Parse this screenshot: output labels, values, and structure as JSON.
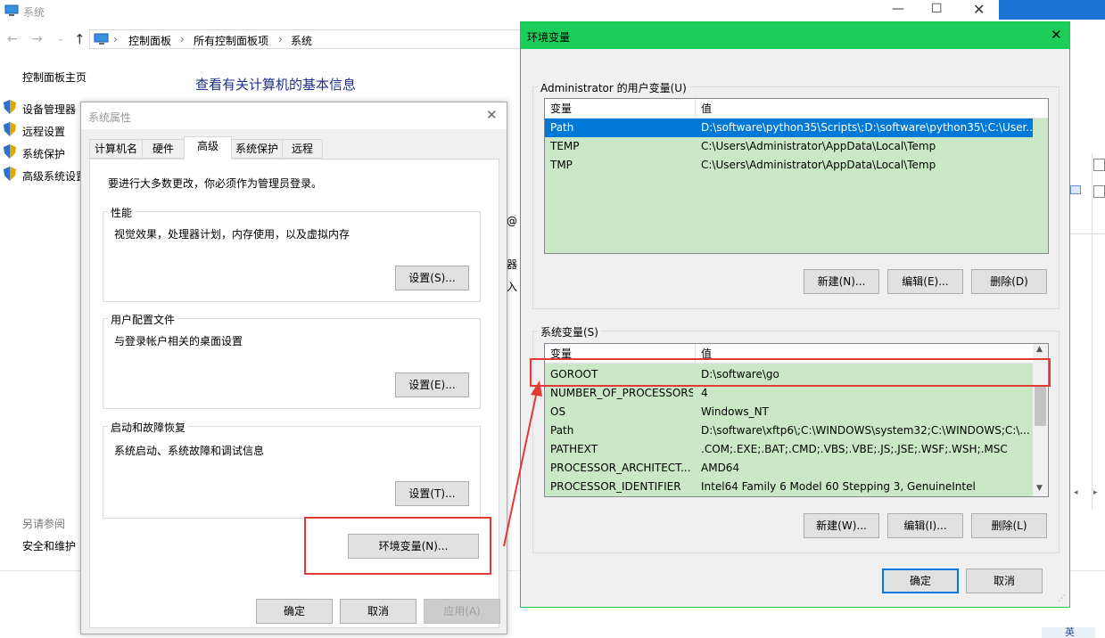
{
  "background_window": {
    "title": "系统",
    "breadcrumb": [
      "控制面板",
      "所有控制面板项",
      "系统"
    ],
    "heading": "查看有关计算机的基本信息",
    "left_nav": {
      "home": "控制面板主页",
      "items": [
        "设备管理器",
        "远程设置",
        "系统保护",
        "高级系统设置"
      ],
      "see_also": "另请参阅",
      "security": "安全和维护"
    },
    "partial_text": [
      "@",
      "器",
      "入"
    ]
  },
  "system_properties": {
    "title": "系统属性",
    "tabs": [
      "计算机名",
      "硬件",
      "高级",
      "系统保护",
      "远程"
    ],
    "active_tab": "高级",
    "admin_note": "要进行大多数更改，你必须作为管理员登录。",
    "performance": {
      "label": "性能",
      "desc": "视觉效果，处理器计划，内存使用，以及虚拟内存",
      "button": "设置(S)..."
    },
    "user_profiles": {
      "label": "用户配置文件",
      "desc": "与登录帐户相关的桌面设置",
      "button": "设置(E)..."
    },
    "startup_recovery": {
      "label": "启动和故障恢复",
      "desc": "系统启动、系统故障和调试信息",
      "button": "设置(T)..."
    },
    "env_button": "环境变量(N)...",
    "ok": "确定",
    "cancel": "取消",
    "apply": "应用(A)"
  },
  "env_dialog": {
    "title": "环境变量",
    "user_group_label": "Administrator 的用户变量(U)",
    "col_var": "变量",
    "col_val": "值",
    "user_vars": [
      {
        "name": "Path",
        "value": "D:\\software\\python35\\Scripts\\;D:\\software\\python35\\;C:\\User...",
        "selected": true
      },
      {
        "name": "TEMP",
        "value": "C:\\Users\\Administrator\\AppData\\Local\\Temp",
        "selected": false
      },
      {
        "name": "TMP",
        "value": "C:\\Users\\Administrator\\AppData\\Local\\Temp",
        "selected": false
      }
    ],
    "user_buttons": [
      "新建(N)...",
      "编辑(E)...",
      "删除(D)"
    ],
    "sys_group_label": "系统变量(S)",
    "sys_vars": [
      {
        "name": "GOROOT",
        "value": "D:\\software\\go"
      },
      {
        "name": "NUMBER_OF_PROCESSORS",
        "value": "4"
      },
      {
        "name": "OS",
        "value": "Windows_NT"
      },
      {
        "name": "Path",
        "value": "D:\\software\\xftp6\\;C:\\WINDOWS\\system32;C:\\WINDOWS;C:\\..."
      },
      {
        "name": "PATHEXT",
        "value": ".COM;.EXE;.BAT;.CMD;.VBS;.VBE;.JS;.JSE;.WSF;.WSH;.MSC"
      },
      {
        "name": "PROCESSOR_ARCHITECT...",
        "value": "AMD64"
      },
      {
        "name": "PROCESSOR_IDENTIFIER",
        "value": "Intel64 Family 6 Model 60 Stepping 3, GenuineIntel"
      }
    ],
    "sys_buttons": [
      "新建(W)...",
      "编辑(I)...",
      "删除(L)"
    ],
    "ok": "确定",
    "cancel": "取消"
  },
  "taskbar_partial": "英",
  "colors": {
    "accent_blue": "#0078d7",
    "list_green": "#cbe8c6",
    "title_green": "#1cce59",
    "highlight_red": "#e53935"
  }
}
